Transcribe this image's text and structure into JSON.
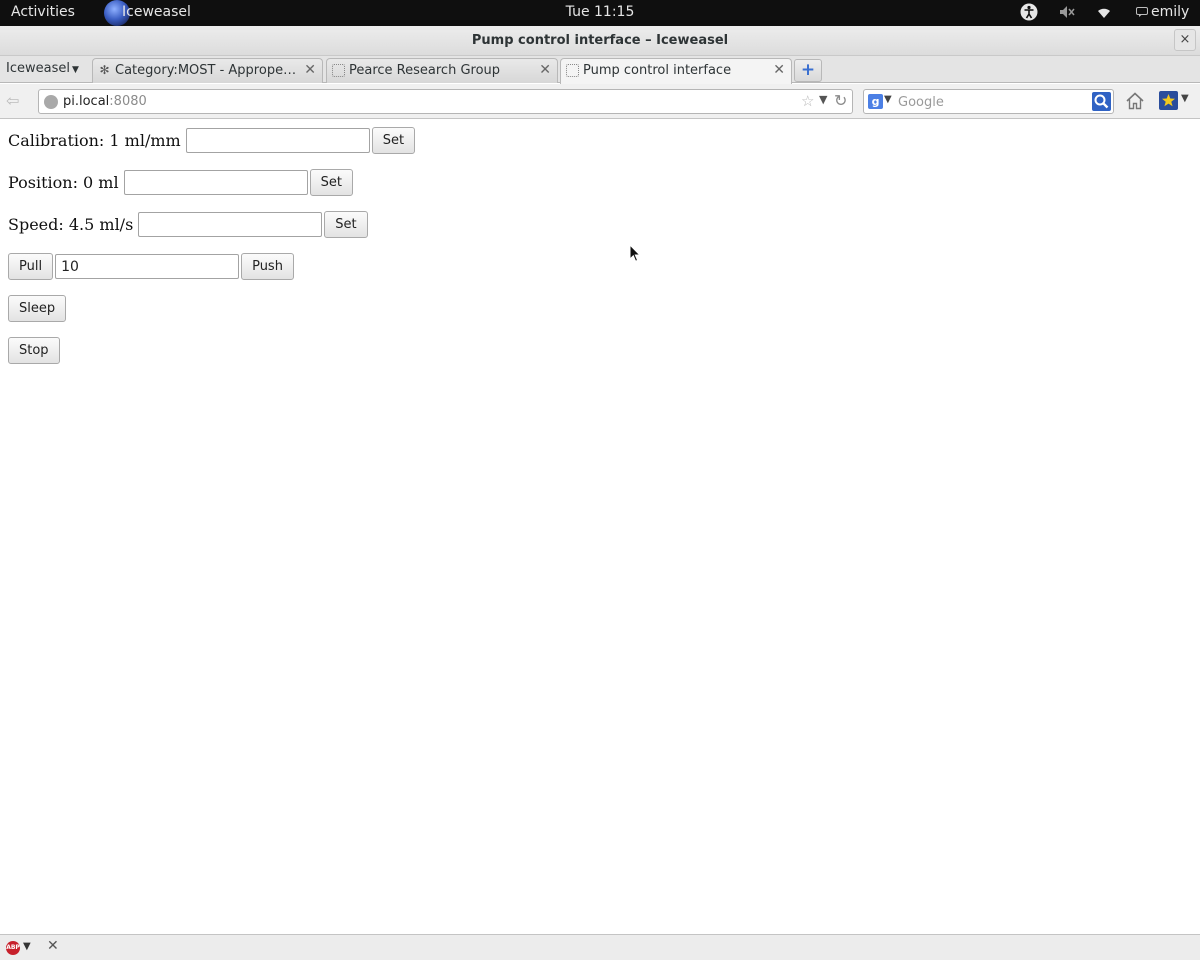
{
  "topbar": {
    "activities": "Activities",
    "app_name": "Iceweasel",
    "clock": "Tue 11:15",
    "user": "emily",
    "icons": [
      "accessibility-icon",
      "volume-muted-icon",
      "wifi-icon",
      "chat-icon"
    ]
  },
  "window": {
    "title": "Pump control interface – Iceweasel",
    "close_glyph": "×"
  },
  "tabbar": {
    "menu_label": "Iceweasel",
    "tabs": [
      {
        "label": "Category:MOST - Appropedi...",
        "favicon": "appropedia-icon",
        "active": false
      },
      {
        "label": "Pearce Research Group",
        "favicon": "blank-page-icon",
        "active": false
      },
      {
        "label": "Pump control interface",
        "favicon": "blank-page-icon",
        "active": true
      }
    ],
    "close_glyph": "✕",
    "new_tab_glyph": "+"
  },
  "navbar": {
    "url_host": "pi.local",
    "url_port": ":8080",
    "search_engine": "g",
    "search_placeholder": "Google"
  },
  "page": {
    "calibration": {
      "label": "Calibration: 1 ml/mm",
      "value": "",
      "button": "Set"
    },
    "position": {
      "label": "Position: 0 ml",
      "value": "",
      "button": "Set"
    },
    "speed": {
      "label": "Speed: 4.5 ml/s",
      "value": "",
      "button": "Set"
    },
    "move": {
      "pull_button": "Pull",
      "amount": "10",
      "push_button": "Push"
    },
    "sleep_button": "Sleep",
    "stop_button": "Stop"
  },
  "addonbar": {
    "abp_label": "ABP",
    "close_glyph": "✕"
  },
  "colors": {
    "topbar_bg": "#0f0f0f",
    "accent_blue": "#3a6fd0",
    "abp_red": "#c7202b"
  }
}
